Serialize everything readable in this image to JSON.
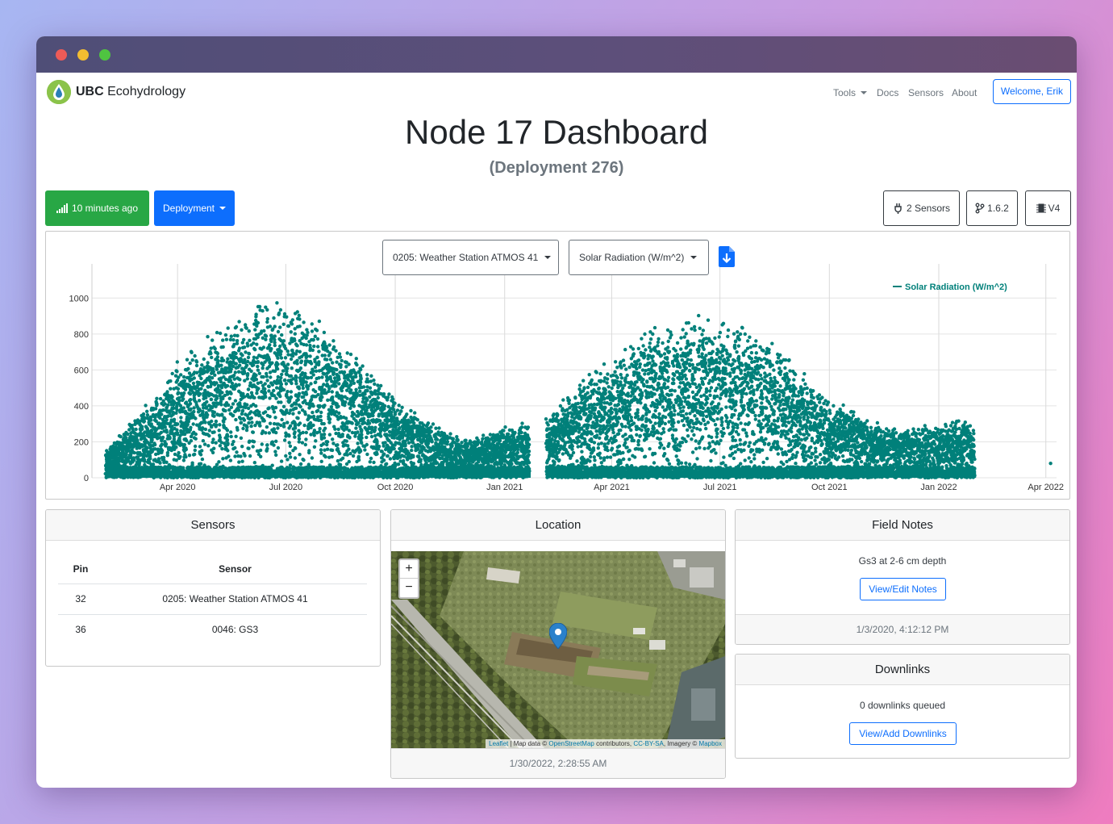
{
  "navbar": {
    "brand_bold": "UBC",
    "brand_rest": "Ecohydrology",
    "links": [
      "Tools",
      "Docs",
      "Sensors",
      "About"
    ],
    "welcome": "Welcome, Erik"
  },
  "header": {
    "title_strong": "Node 17",
    "title_light": "Dashboard",
    "subtitle": "(Deployment 276)"
  },
  "toolbar": {
    "status": "10 minutes ago",
    "deployment": "Deployment",
    "sensors_count": "2 Sensors",
    "version": "1.6.2",
    "hardware": "V4"
  },
  "chart_controls": {
    "sensor_select": "0205: Weather Station ATMOS 41",
    "measure_select": "Solar Radiation (W/m^2)"
  },
  "chart_data": {
    "type": "scatter",
    "series": [
      {
        "name": "Solar Radiation (W/m^2)",
        "color": "#00807a"
      }
    ],
    "x_ticks": [
      "Apr 2020",
      "Jul 2020",
      "Oct 2020",
      "Jan 2021",
      "Apr 2021",
      "Jul 2021",
      "Oct 2021",
      "Jan 2022",
      "Apr 2022"
    ],
    "y_ticks": [
      0,
      200,
      400,
      600,
      800,
      1000
    ],
    "ylim": [
      0,
      1100
    ],
    "envelope": [
      {
        "x": "2020-02-01",
        "y": 150
      },
      {
        "x": "2020-02-15",
        "y": 250
      },
      {
        "x": "2020-03-01",
        "y": 350
      },
      {
        "x": "2020-04-01",
        "y": 620
      },
      {
        "x": "2020-05-01",
        "y": 790
      },
      {
        "x": "2020-06-01",
        "y": 930
      },
      {
        "x": "2020-07-01",
        "y": 950
      },
      {
        "x": "2020-08-01",
        "y": 860
      },
      {
        "x": "2020-09-01",
        "y": 650
      },
      {
        "x": "2020-10-01",
        "y": 430
      },
      {
        "x": "2020-11-01",
        "y": 300
      },
      {
        "x": "2020-12-01",
        "y": 200
      },
      {
        "x": "2021-01-01",
        "y": 280
      },
      {
        "x": "2021-02-01",
        "y": 310
      },
      {
        "x": "2021-02-15",
        "y": 380
      },
      {
        "x": "2021-03-01",
        "y": 500
      },
      {
        "x": "2021-04-01",
        "y": 650
      },
      {
        "x": "2021-05-01",
        "y": 790
      },
      {
        "x": "2021-06-01",
        "y": 860
      },
      {
        "x": "2021-07-01",
        "y": 870
      },
      {
        "x": "2021-08-01",
        "y": 800
      },
      {
        "x": "2021-09-01",
        "y": 620
      },
      {
        "x": "2021-10-01",
        "y": 430
      },
      {
        "x": "2021-11-01",
        "y": 330
      },
      {
        "x": "2021-12-01",
        "y": 270
      },
      {
        "x": "2022-01-01",
        "y": 290
      },
      {
        "x": "2022-01-31",
        "y": 330
      }
    ],
    "gaps": [
      [
        "2021-01-22",
        "2021-02-05"
      ]
    ],
    "last_point": {
      "x": "2022-04-05",
      "y": 80
    },
    "xlabel": "",
    "ylabel": "",
    "legend": "top-right",
    "grid": true
  },
  "sensors_card": {
    "title": "Sensors",
    "columns": [
      "Pin",
      "Sensor"
    ],
    "rows": [
      {
        "pin": "32",
        "sensor": "0205: Weather Station ATMOS 41"
      },
      {
        "pin": "36",
        "sensor": "0046: GS3"
      }
    ]
  },
  "location_card": {
    "title": "Location",
    "zoom_in": "+",
    "zoom_out": "−",
    "attribution": {
      "leaflet": "Leaflet",
      "sep1": " | Map data © ",
      "osm": "OpenStreetMap",
      "contrib": " contributors, ",
      "license": "CC-BY-SA",
      "imagery": ", Imagery © ",
      "mapbox": "Mapbox"
    },
    "footer": "1/30/2022, 2:28:55 AM"
  },
  "field_notes_card": {
    "title": "Field Notes",
    "note": "Gs3 at 2-6 cm depth",
    "button": "View/Edit Notes",
    "footer": "1/3/2020, 4:12:12 PM"
  },
  "downlinks_card": {
    "title": "Downlinks",
    "text": "0 downlinks queued",
    "button": "View/Add Downlinks"
  },
  "colors": {
    "success": "#28a745",
    "primary": "#0d6efd",
    "series": "#00807a"
  }
}
